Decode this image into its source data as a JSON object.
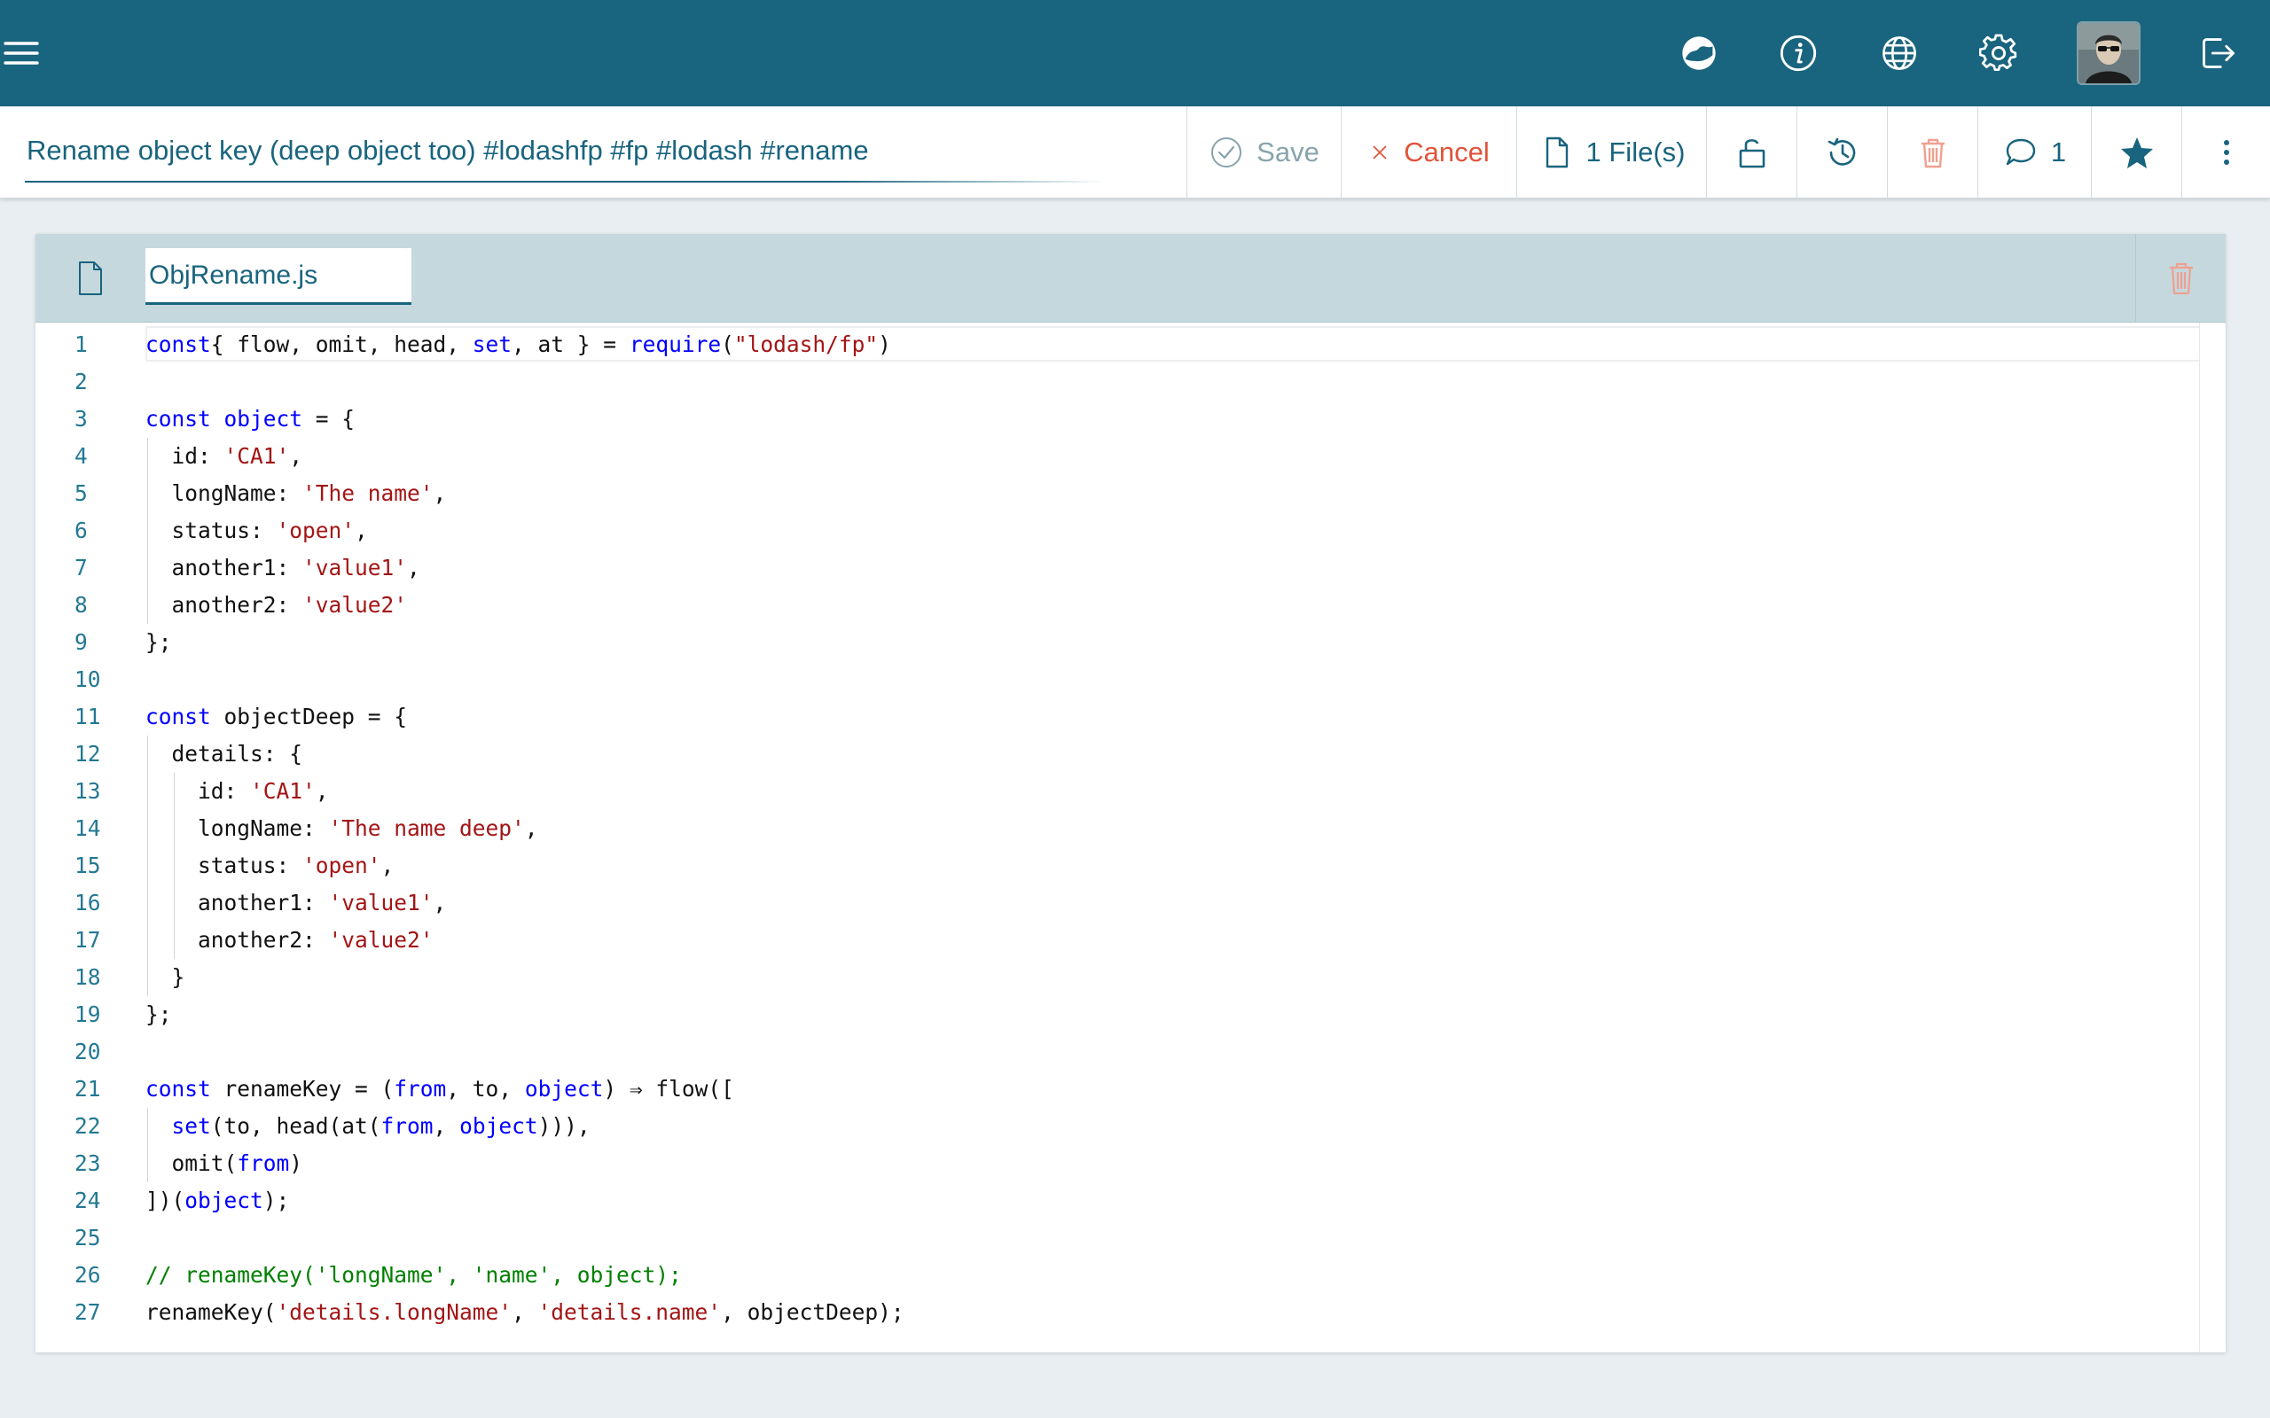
{
  "app": {
    "menu_icon": "hamburger-menu-icon",
    "header_icons": [
      "dashboard-icon",
      "info-icon",
      "globe-icon",
      "gear-icon",
      "user-avatar",
      "logout-icon"
    ],
    "colors": {
      "primary": "#19647e",
      "cancel": "#e0533a",
      "danger": "#f0a090",
      "background": "#e8eef1"
    }
  },
  "snippet": {
    "title": "Rename object key (deep object too) #lodashfp #fp #lodash #rename"
  },
  "toolbar": {
    "save_label": "Save",
    "cancel_label": "Cancel",
    "files_label": "1 File(s)",
    "comments_count": "1"
  },
  "file": {
    "name": "ObjRename.js"
  },
  "code_lines": [
    {
      "n": "1",
      "indent": 0,
      "tokens": [
        [
          "kw",
          "const"
        ],
        [
          "",
          "{ flow, omit, head, "
        ],
        [
          "kw",
          "set"
        ],
        [
          "",
          ", at } = "
        ],
        [
          "kw",
          "require"
        ],
        [
          "",
          "("
        ],
        [
          "str",
          "\"lodash/fp\""
        ],
        [
          "",
          ")"
        ]
      ]
    },
    {
      "n": "2",
      "indent": 0,
      "tokens": []
    },
    {
      "n": "3",
      "indent": 0,
      "tokens": [
        [
          "kw",
          "const"
        ],
        [
          "",
          " "
        ],
        [
          "kw",
          "object"
        ],
        [
          "",
          " = {"
        ]
      ]
    },
    {
      "n": "4",
      "indent": 1,
      "tokens": [
        [
          "",
          "id: "
        ],
        [
          "str",
          "'CA1'"
        ],
        [
          "",
          ","
        ]
      ]
    },
    {
      "n": "5",
      "indent": 1,
      "tokens": [
        [
          "",
          "longName: "
        ],
        [
          "str",
          "'The name'"
        ],
        [
          "",
          ","
        ]
      ]
    },
    {
      "n": "6",
      "indent": 1,
      "tokens": [
        [
          "",
          "status: "
        ],
        [
          "str",
          "'open'"
        ],
        [
          "",
          ","
        ]
      ]
    },
    {
      "n": "7",
      "indent": 1,
      "tokens": [
        [
          "",
          "another1: "
        ],
        [
          "str",
          "'value1'"
        ],
        [
          "",
          ","
        ]
      ]
    },
    {
      "n": "8",
      "indent": 1,
      "tokens": [
        [
          "",
          "another2: "
        ],
        [
          "str",
          "'value2'"
        ]
      ]
    },
    {
      "n": "9",
      "indent": 0,
      "tokens": [
        [
          "",
          "};"
        ]
      ]
    },
    {
      "n": "10",
      "indent": 0,
      "tokens": []
    },
    {
      "n": "11",
      "indent": 0,
      "tokens": [
        [
          "kw",
          "const"
        ],
        [
          "",
          " objectDeep = {"
        ]
      ]
    },
    {
      "n": "12",
      "indent": 1,
      "tokens": [
        [
          "",
          "details: {"
        ]
      ]
    },
    {
      "n": "13",
      "indent": 2,
      "tokens": [
        [
          "",
          "id: "
        ],
        [
          "str",
          "'CA1'"
        ],
        [
          "",
          ","
        ]
      ]
    },
    {
      "n": "14",
      "indent": 2,
      "tokens": [
        [
          "",
          "longName: "
        ],
        [
          "str",
          "'The name deep'"
        ],
        [
          "",
          ","
        ]
      ]
    },
    {
      "n": "15",
      "indent": 2,
      "tokens": [
        [
          "",
          "status: "
        ],
        [
          "str",
          "'open'"
        ],
        [
          "",
          ","
        ]
      ]
    },
    {
      "n": "16",
      "indent": 2,
      "tokens": [
        [
          "",
          "another1: "
        ],
        [
          "str",
          "'value1'"
        ],
        [
          "",
          ","
        ]
      ]
    },
    {
      "n": "17",
      "indent": 2,
      "tokens": [
        [
          "",
          "another2: "
        ],
        [
          "str",
          "'value2'"
        ]
      ]
    },
    {
      "n": "18",
      "indent": 1,
      "tokens": [
        [
          "",
          "}"
        ]
      ]
    },
    {
      "n": "19",
      "indent": 0,
      "tokens": [
        [
          "",
          "};"
        ]
      ]
    },
    {
      "n": "20",
      "indent": 0,
      "tokens": []
    },
    {
      "n": "21",
      "indent": 0,
      "tokens": [
        [
          "kw",
          "const"
        ],
        [
          "",
          " renameKey = ("
        ],
        [
          "kw",
          "from"
        ],
        [
          "",
          ", to, "
        ],
        [
          "kw",
          "object"
        ],
        [
          "",
          ") ⇒ flow(["
        ]
      ]
    },
    {
      "n": "22",
      "indent": 1,
      "tokens": [
        [
          "kw",
          "set"
        ],
        [
          "",
          "(to, head(at("
        ],
        [
          "kw",
          "from"
        ],
        [
          "",
          ", "
        ],
        [
          "kw",
          "object"
        ],
        [
          "",
          ")))"
        ],
        [
          "",
          ","
        ]
      ]
    },
    {
      "n": "23",
      "indent": 1,
      "tokens": [
        [
          "",
          "omit("
        ],
        [
          "kw",
          "from"
        ],
        [
          "",
          ")"
        ]
      ]
    },
    {
      "n": "24",
      "indent": 0,
      "tokens": [
        [
          "",
          "])("
        ],
        [
          "kw",
          "object"
        ],
        [
          "",
          ");"
        ]
      ]
    },
    {
      "n": "25",
      "indent": 0,
      "tokens": []
    },
    {
      "n": "26",
      "indent": 0,
      "tokens": [
        [
          "cm",
          "// renameKey('longName', 'name', object);"
        ]
      ]
    },
    {
      "n": "27",
      "indent": 0,
      "tokens": [
        [
          "",
          "renameKey("
        ],
        [
          "str",
          "'details.longName'"
        ],
        [
          "",
          ", "
        ],
        [
          "str",
          "'details.name'"
        ],
        [
          "",
          ", objectDeep);"
        ]
      ]
    }
  ]
}
